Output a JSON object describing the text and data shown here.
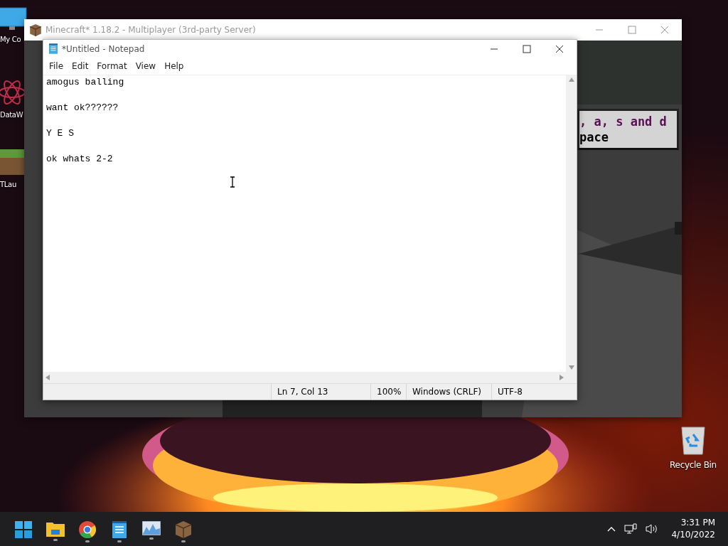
{
  "desktop_icons": [
    {
      "kind": "computer",
      "label": "My Co"
    },
    {
      "kind": "atom",
      "label": "DataW"
    },
    {
      "kind": "grass",
      "label": "TLau"
    },
    {
      "kind": "recycle",
      "label": "Recycle Bin"
    }
  ],
  "game_window": {
    "title": "Minecraft* 1.18.2 - Multiplayer (3rd-party Server)",
    "active": false,
    "tooltip_lines": [
      {
        "text": ", a, s and d",
        "color": "#5a0f55"
      },
      {
        "text": "pace",
        "color": "#000000"
      }
    ]
  },
  "notepad": {
    "title": "*Untitled - Notepad",
    "active": true,
    "menu": [
      "File",
      "Edit",
      "Format",
      "View",
      "Help"
    ],
    "content": "amogus balling\n\nwant ok??????\n\nY E S\n\nok whats 2-2",
    "status_bar": [
      "Ln 7, Col 13",
      "100%",
      "Windows (CRLF)",
      "UTF-8"
    ]
  },
  "taskbar": {
    "apps": [
      {
        "kind": "start",
        "running": false
      },
      {
        "kind": "folder",
        "running": true
      },
      {
        "kind": "browser",
        "running": true
      },
      {
        "kind": "notepad",
        "running": true
      },
      {
        "kind": "chart",
        "running": true
      },
      {
        "kind": "crate",
        "running": true
      }
    ],
    "time": "3:31 PM",
    "date": "4/10/2022"
  }
}
